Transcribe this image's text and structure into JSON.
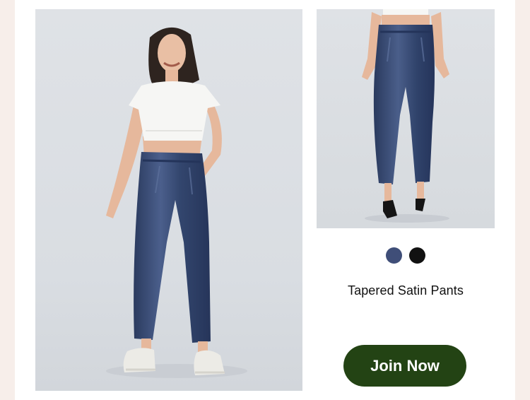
{
  "product": {
    "name": "Tapered Satin Pants",
    "swatches": [
      {
        "name": "navy",
        "color": "#3f4e78"
      },
      {
        "name": "black",
        "color": "#111111"
      }
    ]
  },
  "cta": {
    "label": "Join Now"
  },
  "images": {
    "main": "model-front-view-photo",
    "side": "pants-close-up-photo"
  },
  "colors": {
    "background": "#f7eeea",
    "card": "#ffffff",
    "photo_bg": "#dde0e4",
    "button": "#234314",
    "pants": "#34476e"
  }
}
